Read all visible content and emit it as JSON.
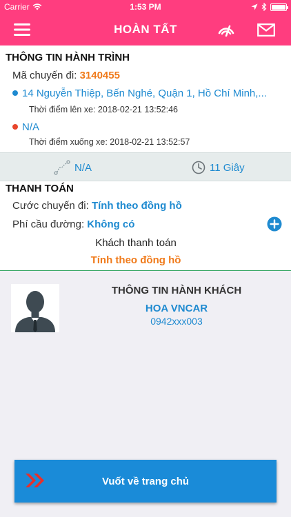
{
  "status_bar": {
    "carrier": "Carrier",
    "time": "1:53 PM"
  },
  "navbar": {
    "title": "HOÀN TẤT"
  },
  "trip": {
    "section_title": "THÔNG TIN HÀNH TRÌNH",
    "trip_code_label": "Mã chuyến đi:",
    "trip_code": "3140455",
    "pickup_address": "14 Nguyễn Thiệp, Bến Nghé, Quận 1, Hồ Chí Minh,...",
    "pickup_time_label": "Thời điểm lên xe:",
    "pickup_time": "2018-02-21 13:52:46",
    "dropoff_address": "N/A",
    "dropoff_time_label": "Thời điểm xuống xe:",
    "dropoff_time": "2018-02-21 13:52:57"
  },
  "summary": {
    "distance": "N/A",
    "duration": "11 Giây"
  },
  "payment": {
    "section_title": "THANH TOÁN",
    "fare_label": "Cước chuyến đi:",
    "fare_value": "Tính theo đồng hồ",
    "toll_label": "Phí cầu đường:",
    "toll_value": "Không có",
    "payer_label": "Khách thanh toán",
    "payer_value": "Tính theo đồng hồ"
  },
  "passenger": {
    "title": "THÔNG TIN HÀNH KHÁCH",
    "name": "HOA VNCAR",
    "phone": "0942xxx003"
  },
  "home_button": {
    "label": "Vuốt về trang chủ"
  },
  "colors": {
    "brand": "#ff3d7f",
    "accent_blue": "#1e8ad0",
    "accent_orange": "#f07a1a",
    "button_blue": "#1a8bd8",
    "pickup_dot": "#1e8ad0",
    "dropoff_dot": "#e8452c"
  }
}
